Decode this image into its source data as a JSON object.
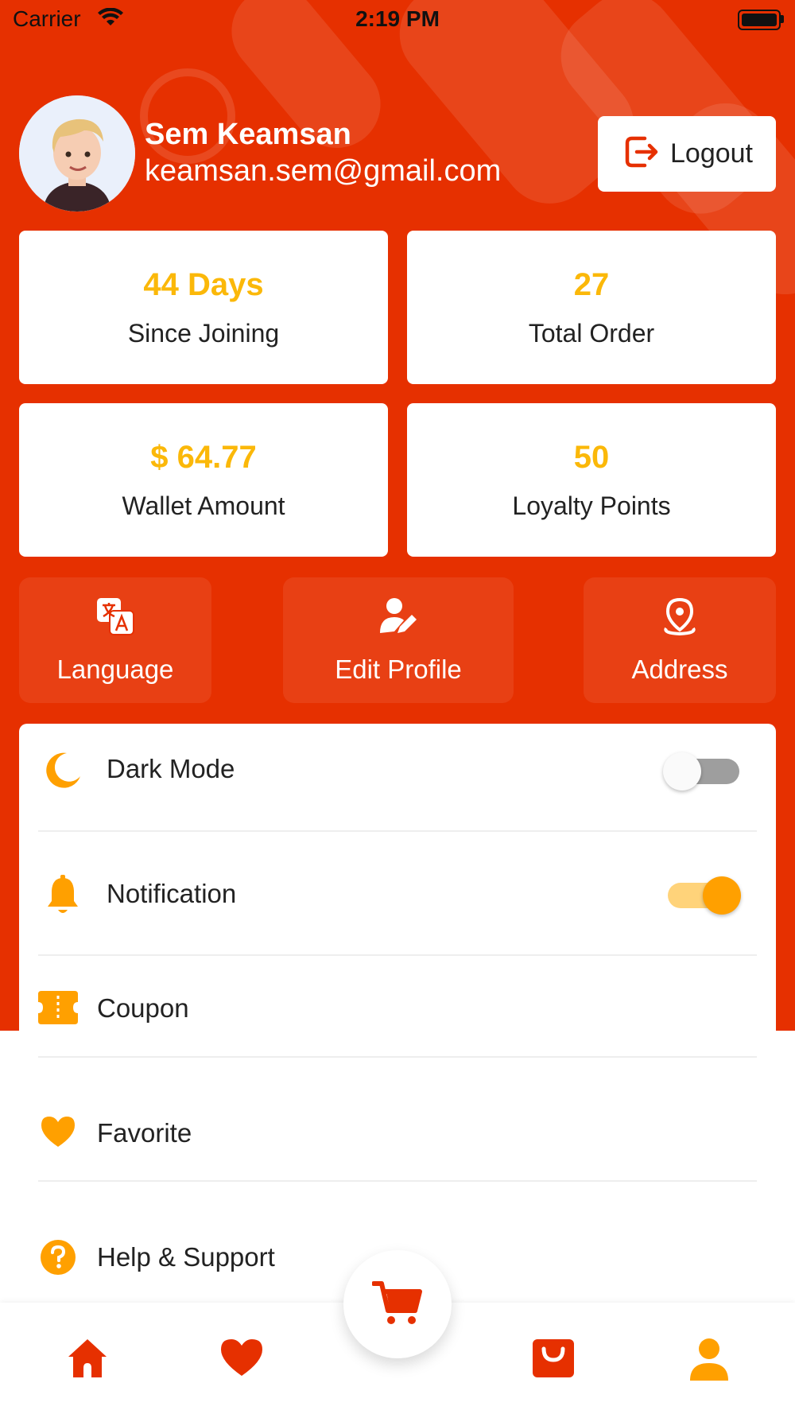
{
  "status_bar": {
    "carrier": "Carrier",
    "time": "2:19 PM"
  },
  "profile": {
    "name": "Sem Keamsan",
    "email": "keamsan.sem@gmail.com",
    "logout_label": "Logout"
  },
  "stats": [
    {
      "value": "44 Days",
      "label": "Since Joining"
    },
    {
      "value": "27",
      "label": "Total Order"
    },
    {
      "value": "$ 64.77",
      "label": "Wallet Amount"
    },
    {
      "value": "50",
      "label": "Loyalty Points"
    }
  ],
  "quick_actions": [
    {
      "label": "Language",
      "icon": "translate-icon"
    },
    {
      "label": "Edit Profile",
      "icon": "edit-profile-icon"
    },
    {
      "label": "Address",
      "icon": "location-pin-icon"
    }
  ],
  "settings": [
    {
      "label": "Dark Mode",
      "icon": "moon-icon",
      "toggle": false
    },
    {
      "label": "Notification",
      "icon": "bell-icon",
      "toggle": true
    },
    {
      "label": "Coupon",
      "icon": "coupon-icon"
    },
    {
      "label": "Favorite",
      "icon": "heart-icon"
    },
    {
      "label": "Help & Support",
      "icon": "help-icon"
    }
  ],
  "bottom_nav": [
    "home-icon",
    "heart-icon",
    "cart-icon",
    "shopping-bag-icon",
    "user-icon"
  ],
  "colors": {
    "primary": "#e63000",
    "accent": "#fbb809",
    "icon_orange": "#ffa000"
  }
}
